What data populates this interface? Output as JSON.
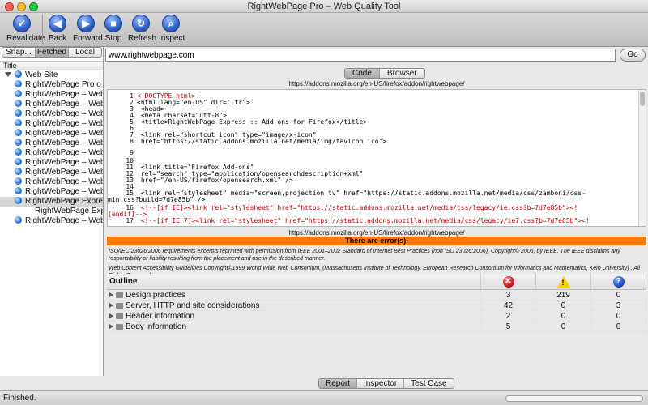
{
  "window": {
    "title": "RightWebPage Pro – Web Quality Tool",
    "traffic_colors": [
      "#ff5f57",
      "#febc2e",
      "#28c840"
    ]
  },
  "toolbar": {
    "buttons": [
      {
        "label": "Revalidate",
        "icon": "checkmark-icon",
        "glyph": "✓"
      },
      {
        "label": "Back",
        "icon": "back-arrow-icon",
        "glyph": "◀"
      },
      {
        "label": "Forward",
        "icon": "forward-arrow-icon",
        "glyph": "▶"
      },
      {
        "label": "Stop",
        "icon": "stop-icon",
        "glyph": "■"
      },
      {
        "label": "Refresh",
        "icon": "refresh-icon",
        "glyph": "↻"
      },
      {
        "label": "Inspect",
        "icon": "magnifier-icon",
        "glyph": "⌕"
      }
    ]
  },
  "sidebar": {
    "segments": [
      "Snap...",
      "Fetched",
      "Local"
    ],
    "active_segment": "Fetched",
    "column_title": "Title",
    "root": "Web Site",
    "items": [
      "RightWebPage Pro o",
      "RightWebPage – Web",
      "RightWebPage – Web",
      "RightWebPage – Web",
      "RightWebPage – Web",
      "RightWebPage – Web",
      "RightWebPage – Web",
      "RightWebPage – Web",
      "RightWebPage – Web",
      "RightWebPage – Web",
      "RightWebPage – Web",
      "RightWebPage – Web",
      "RightWebPage Expre",
      "RightWebPage Exp",
      "RightWebPage – Web"
    ],
    "selected_index": 12
  },
  "address": {
    "url": "www.rightwebpage.com",
    "go_label": "Go"
  },
  "view_tabs": {
    "items": [
      "Code",
      "Browser"
    ],
    "active": "Code"
  },
  "code_pane": {
    "caption": "https://addons.mozilla.org/en-US/firefox/addon/rightwebpage/",
    "lines": [
      {
        "num": "1",
        "text": "<!DOCTYPE html>",
        "red": true
      },
      {
        "num": "2",
        "text": "<html lang=\"en-US\" dir=\"ltr\">",
        "red": false
      },
      {
        "num": "3",
        "text": "  <head>",
        "red": false
      },
      {
        "num": "4",
        "text": "    <meta charset=\"utf-8\">",
        "red": false
      },
      {
        "num": "5",
        "text": "          <title>RightWebPage Express :: Add-ons for Firefox</title>",
        "red": false
      },
      {
        "num": "6",
        "text": "",
        "red": false
      },
      {
        "num": "7",
        "text": "    <link rel=\"shortcut icon\" type=\"image/x-icon\"",
        "red": false
      },
      {
        "num": "8",
        "text": "          href=\"https://static.addons.mozilla.net/media/img/favicon.ico\">",
        "red": false
      },
      {
        "num": "9",
        "text": "",
        "red": false
      },
      {
        "num": "10",
        "text": "",
        "red": false
      },
      {
        "num": "11",
        "text": "        <link title=\"Firefox Add-ons\"",
        "red": false
      },
      {
        "num": "12",
        "text": "          rel=\"search\" type=\"application/opensearchdescription+xml\"",
        "red": false
      },
      {
        "num": "13",
        "text": "          href=\"/en-US/firefox/opensearch.xml\" />",
        "red": false
      },
      {
        "num": "14",
        "text": "",
        "red": false
      },
      {
        "num": "15",
        "text": "          <link rel=\"stylesheet\" media=\"screen,projection,tv\" href=\"https://static.addons.mozilla.net/media/css/zamboni/css-",
        "red": false
      },
      {
        "num": "",
        "text": "min.css?build=7d7e85b\" />",
        "red": false
      },
      {
        "num": "16",
        "text": "        <!--[if IE]><link rel=\"stylesheet\" href=\"https://static.addons.mozilla.net/media/css/legacy/ie.css?b=7d7e85b\"><!",
        "red": true
      },
      {
        "num": "",
        "text": "[endif]-->",
        "red": true
      },
      {
        "num": "17",
        "text": "        <!--[if IE 7]><link rel=\"stylesheet\" href=\"https://static.addons.mozilla.net/media/css/legacy/ie7.css?b=7d7e85b\"><!",
        "red": true
      }
    ]
  },
  "report": {
    "caption": "https://addons.mozilla.org/en-US/firefox/addon/rightwebpage/",
    "error_banner": "There are error(s).",
    "error_color": "#f47a0c",
    "notice_1": "ISO/IEC 23026:2006 requirements excerpts reprinted with permission from IEEE 2001–2002 Standard of Internet Best Practices (non ISO 23026:2006), Copyright© 2006, by IEEE. The IEEE disclaims any responsibility or liability resulting from the placement and use in the described manner.",
    "notice_2": "Web Content Accessibility Guidelines Copyright©1999 World Wide Web Consortium, (Massachusetts Institute of Technology, European Research Consortium for Informatics and Mathematics, Keio University) . All Rights Reserved.",
    "outline_header": "Outline",
    "columns": [
      {
        "icon": "error-icon"
      },
      {
        "icon": "warning-icon"
      },
      {
        "icon": "question-icon"
      }
    ],
    "rows": [
      {
        "label": "Design practices",
        "errors": "3",
        "warnings": "219",
        "questions": "0"
      },
      {
        "label": "Server, HTTP and site considerations",
        "errors": "42",
        "warnings": "0",
        "questions": "3"
      },
      {
        "label": "Header information",
        "errors": "2",
        "warnings": "0",
        "questions": "0"
      },
      {
        "label": "Body information",
        "errors": "5",
        "warnings": "0",
        "questions": "0"
      }
    ]
  },
  "bottom_tabs": {
    "items": [
      "Report",
      "Inspector",
      "Test Case"
    ],
    "active": "Report"
  },
  "status": {
    "text": "Finished."
  }
}
